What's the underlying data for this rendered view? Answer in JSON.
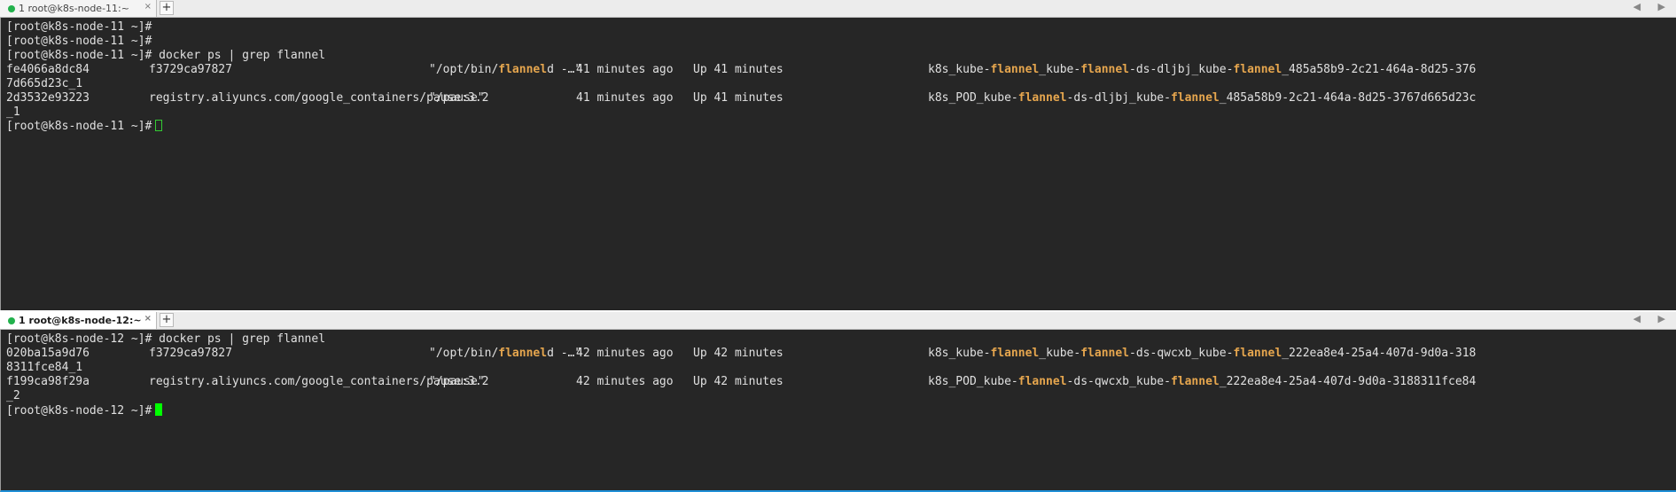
{
  "top_pane": {
    "tab": {
      "title": "1 root@k8s-node-11:~",
      "close": "×",
      "status_color": "#22b14c"
    },
    "add_tab": "+",
    "scroll_arrows": "◀ ▶",
    "lines": [
      "[root@k8s-node-11 ~]#",
      "[root@k8s-node-11 ~]#",
      "[root@k8s-node-11 ~]# docker ps | grep flannel"
    ],
    "rows": [
      {
        "id": "fe4066a8dc84",
        "image": "f3729ca97827",
        "cmd_pre": "\"/opt/bin/",
        "cmd_hl": "flannel",
        "cmd_post": "d -…\"",
        "created": "41 minutes ago",
        "status": "Up 41 minutes",
        "name": [
          {
            "t": "k8s_kube-"
          },
          {
            "t": "flannel",
            "h": true
          },
          {
            "t": "_kube-"
          },
          {
            "t": "flannel",
            "h": true
          },
          {
            "t": "-ds-dljbj_kube-"
          },
          {
            "t": "flannel",
            "h": true
          },
          {
            "t": "_485a58b9-2c21-464a-8d25-376"
          }
        ],
        "wrap": "7d665d23c_1"
      },
      {
        "id": "2d3532e93223",
        "image": "registry.aliyuncs.com/google_containers/pause:3.2",
        "cmd_pre": "\"/pause\"",
        "cmd_hl": "",
        "cmd_post": "",
        "created": "41 minutes ago",
        "status": "Up 41 minutes",
        "name": [
          {
            "t": "k8s_POD_kube-"
          },
          {
            "t": "flannel",
            "h": true
          },
          {
            "t": "-ds-dljbj_kube-"
          },
          {
            "t": "flannel",
            "h": true
          },
          {
            "t": "_485a58b9-2c21-464a-8d25-3767d665d23c"
          }
        ],
        "wrap": "_1"
      }
    ],
    "prompt": "[root@k8s-node-11 ~]#"
  },
  "bottom_pane": {
    "tab": {
      "title": "1 root@k8s-node-12:~",
      "close": "×",
      "status_color": "#22b14c"
    },
    "add_tab": "+",
    "scroll_arrows": "◀ ▶",
    "lines": [
      "[root@k8s-node-12 ~]# docker ps | grep flannel"
    ],
    "rows": [
      {
        "id": "020ba15a9d76",
        "image": "f3729ca97827",
        "cmd_pre": "\"/opt/bin/",
        "cmd_hl": "flannel",
        "cmd_post": "d -…\"",
        "created": "42 minutes ago",
        "status": "Up 42 minutes",
        "name": [
          {
            "t": "k8s_kube-"
          },
          {
            "t": "flannel",
            "h": true
          },
          {
            "t": "_kube-"
          },
          {
            "t": "flannel",
            "h": true
          },
          {
            "t": "-ds-qwcxb_kube-"
          },
          {
            "t": "flannel",
            "h": true
          },
          {
            "t": "_222ea8e4-25a4-407d-9d0a-318"
          }
        ],
        "wrap": "8311fce84_1"
      },
      {
        "id": "f199ca98f29a",
        "image": "registry.aliyuncs.com/google_containers/pause:3.2",
        "cmd_pre": "\"/pause\"",
        "cmd_hl": "",
        "cmd_post": "",
        "created": "42 minutes ago",
        "status": "Up 42 minutes",
        "name": [
          {
            "t": "k8s_POD_kube-"
          },
          {
            "t": "flannel",
            "h": true
          },
          {
            "t": "-ds-qwcxb_kube-"
          },
          {
            "t": "flannel",
            "h": true
          },
          {
            "t": "_222ea8e4-25a4-407d-9d0a-3188311fce84"
          }
        ],
        "wrap": "_2"
      }
    ],
    "prompt": "[root@k8s-node-12 ~]#"
  },
  "colors": {
    "terminal_bg": "#262626",
    "text": "#e0e0e0",
    "highlight": "#e6a64e",
    "cursor": "#00ff00",
    "active_border": "#1f8fd6"
  }
}
